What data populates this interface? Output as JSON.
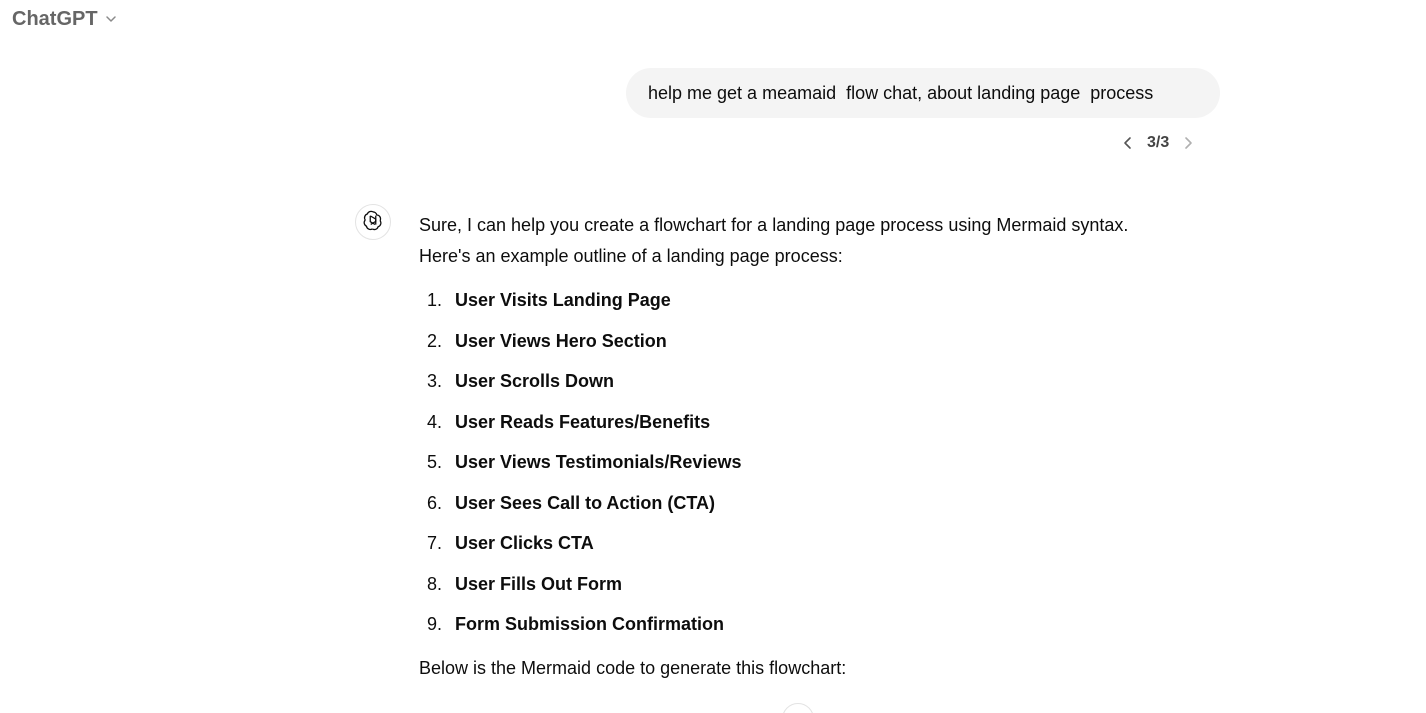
{
  "header": {
    "model_name": "ChatGPT",
    "model_menu_icon": "chevron-down-icon"
  },
  "conversation": {
    "user_message": "help me get a meamaid  flow chat, about landing page  process",
    "pager": {
      "current": 3,
      "total": 3,
      "label": "3/3",
      "prev_icon": "chevron-left-icon",
      "next_icon": "chevron-right-icon"
    },
    "assistant": {
      "avatar_icon": "openai-logo-icon",
      "intro_line1": "Sure, I can help you create a flowchart for a landing page process using Mermaid syntax.",
      "intro_line2": "Here's an example outline of a landing page process:",
      "steps": [
        {
          "number": "1.",
          "label": "User Visits Landing Page"
        },
        {
          "number": "2.",
          "label": "User Views Hero Section"
        },
        {
          "number": "3.",
          "label": "User Scrolls Down"
        },
        {
          "number": "4.",
          "label": "User Reads Features/Benefits"
        },
        {
          "number": "5.",
          "label": "User Views Testimonials/Reviews"
        },
        {
          "number": "6.",
          "label": "User Sees Call to Action (CTA)"
        },
        {
          "number": "7.",
          "label": "User Clicks CTA"
        },
        {
          "number": "8.",
          "label": "User Fills Out Form"
        },
        {
          "number": "9.",
          "label": "Form Submission Confirmation"
        }
      ],
      "outro": "Below is the Mermaid code to generate this flowchart:"
    }
  }
}
